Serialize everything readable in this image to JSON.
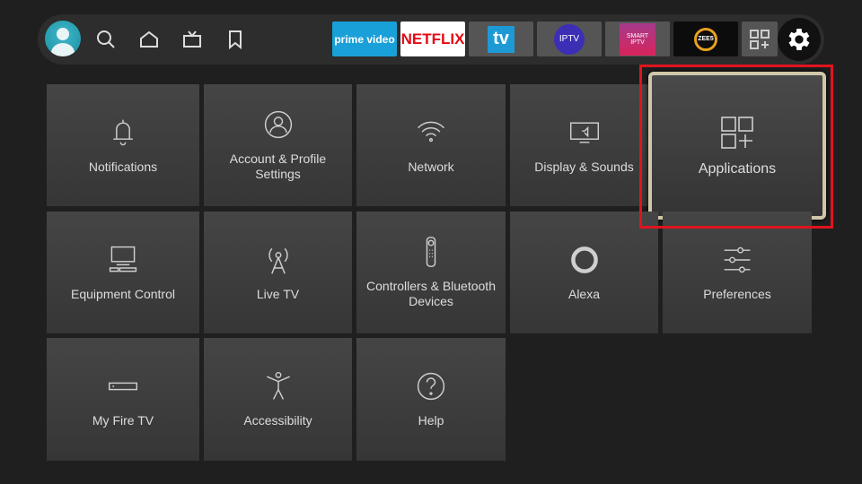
{
  "topbar": {
    "nav": [
      {
        "icon": "search-icon"
      },
      {
        "icon": "home-icon"
      },
      {
        "icon": "live-tv-icon"
      },
      {
        "icon": "bookmark-icon"
      }
    ],
    "apps": [
      {
        "name": "prime video",
        "bg": "#1aa0d8"
      },
      {
        "name": "NETFLIX",
        "bg": "#ffffff",
        "color": "#e50914"
      },
      {
        "name": "tv",
        "bg": "#555555"
      },
      {
        "name": "IPTV",
        "bg": "#555555"
      },
      {
        "name": "SMART IPTV",
        "bg": "#555555"
      },
      {
        "name": "ZEE5",
        "bg": "#0c0c0c"
      }
    ]
  },
  "tiles": [
    {
      "label": "Notifications",
      "icon": "bell-icon"
    },
    {
      "label": "Account & Profile Settings",
      "icon": "profile-icon"
    },
    {
      "label": "Network",
      "icon": "wifi-icon"
    },
    {
      "label": "Display & Sounds",
      "icon": "display-icon"
    },
    {
      "label": "Applications",
      "icon": "apps-icon",
      "focused": true
    },
    {
      "label": "Equipment Control",
      "icon": "equipment-icon"
    },
    {
      "label": "Live TV",
      "icon": "antenna-icon"
    },
    {
      "label": "Controllers & Bluetooth Devices",
      "icon": "remote-icon"
    },
    {
      "label": "Alexa",
      "icon": "alexa-icon"
    },
    {
      "label": "Preferences",
      "icon": "sliders-icon"
    },
    {
      "label": "My Fire TV",
      "icon": "fire-tv-icon"
    },
    {
      "label": "Accessibility",
      "icon": "accessibility-icon"
    },
    {
      "label": "Help",
      "icon": "help-icon"
    }
  ],
  "colors": {
    "highlight": "#e0141e",
    "focus_border": "#cfc7a8"
  }
}
